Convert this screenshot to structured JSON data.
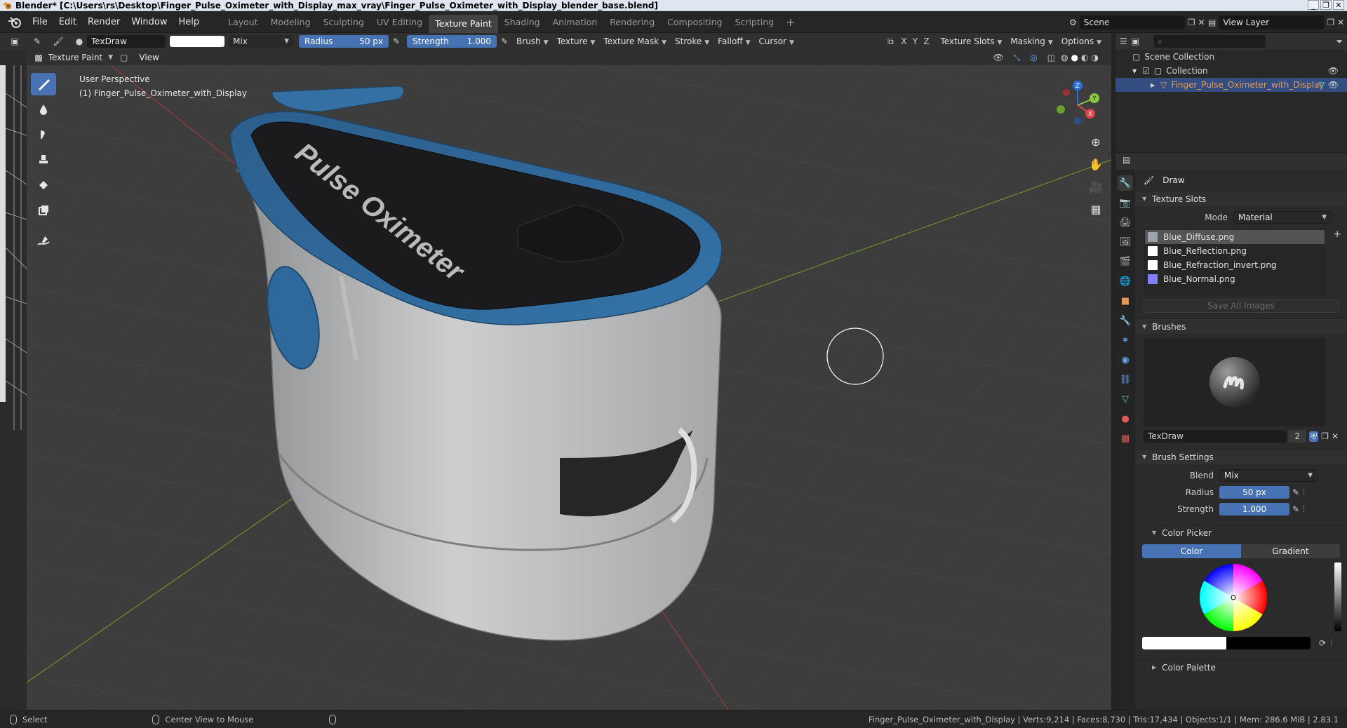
{
  "window": {
    "title": "Blender* [C:\\Users\\rs\\Desktop\\Finger_Pulse_Oximeter_with_Display_max_vray\\Finger_Pulse_Oximeter_with_Display_blender_base.blend]",
    "controls": [
      "_",
      "❐",
      "✕"
    ]
  },
  "menu": {
    "items": [
      "File",
      "Edit",
      "Render",
      "Window",
      "Help"
    ],
    "workspaces": [
      "Layout",
      "Modeling",
      "Sculpting",
      "UV Editing",
      "Texture Paint",
      "Shading",
      "Animation",
      "Rendering",
      "Compositing",
      "Scripting"
    ],
    "active_workspace": "Texture Paint",
    "add_workspace": "+",
    "scene": "Scene",
    "view_layer": "View Layer"
  },
  "toolheader": {
    "brush_name": "TexDraw",
    "blend": "Mix",
    "radius_label": "Radius",
    "radius_value": "50 px",
    "strength_label": "Strength",
    "strength_value": "1.000",
    "menus": [
      "Brush",
      "Texture",
      "Texture Mask",
      "Stroke",
      "Falloff",
      "Cursor"
    ],
    "axis": [
      "X",
      "Y",
      "Z"
    ],
    "right_menus": [
      "Texture Slots",
      "Masking",
      "Options"
    ]
  },
  "modeheader": {
    "mode": "Texture Paint",
    "view": "View"
  },
  "viewport": {
    "perspective": "User Perspective",
    "object_label": "(1) Finger_Pulse_Oximeter_with_Display",
    "device_text": "Pulse Oximeter",
    "gizmo_axes": [
      "Z",
      "Y",
      "X"
    ]
  },
  "outliner": {
    "scene_collection": "Scene Collection",
    "collection": "Collection",
    "object": "Finger_Pulse_Oximeter_with_Display"
  },
  "properties": {
    "tool_name": "Draw",
    "texture_slots": {
      "title": "Texture Slots",
      "mode_label": "Mode",
      "mode_value": "Material",
      "slots": [
        {
          "name": "Blue_Diffuse.png",
          "color": "#9aa3ad"
        },
        {
          "name": "Blue_Reflection.png",
          "color": "#ffffff"
        },
        {
          "name": "Blue_Refraction_invert.png",
          "color": "#ffffff"
        },
        {
          "name": "Blue_Normal.png",
          "color": "#8080ff"
        }
      ],
      "save_all": "Save All Images"
    },
    "brushes": {
      "title": "Brushes",
      "brush_name": "TexDraw",
      "users": "2"
    },
    "brush_settings": {
      "title": "Brush Settings",
      "blend_label": "Blend",
      "blend_value": "Mix",
      "radius_label": "Radius",
      "radius_value": "50 px",
      "strength_label": "Strength",
      "strength_value": "1.000"
    },
    "color_picker": {
      "title": "Color Picker",
      "tab_color": "Color",
      "tab_gradient": "Gradient"
    },
    "color_palette": {
      "title": "Color Palette"
    }
  },
  "statusbar": {
    "select": "Select",
    "center_view": "Center View to Mouse",
    "stats": "Finger_Pulse_Oximeter_with_Display | Verts:9,214 | Faces:8,730 | Tris:17,434 | Objects:1/1 | Mem: 286.6 MiB | 2.83.1"
  },
  "colors": {
    "accent": "#4772b3",
    "device_blue": "#2e6a9e",
    "device_grey": "#c9cacb",
    "device_black": "#1c1c1e"
  }
}
